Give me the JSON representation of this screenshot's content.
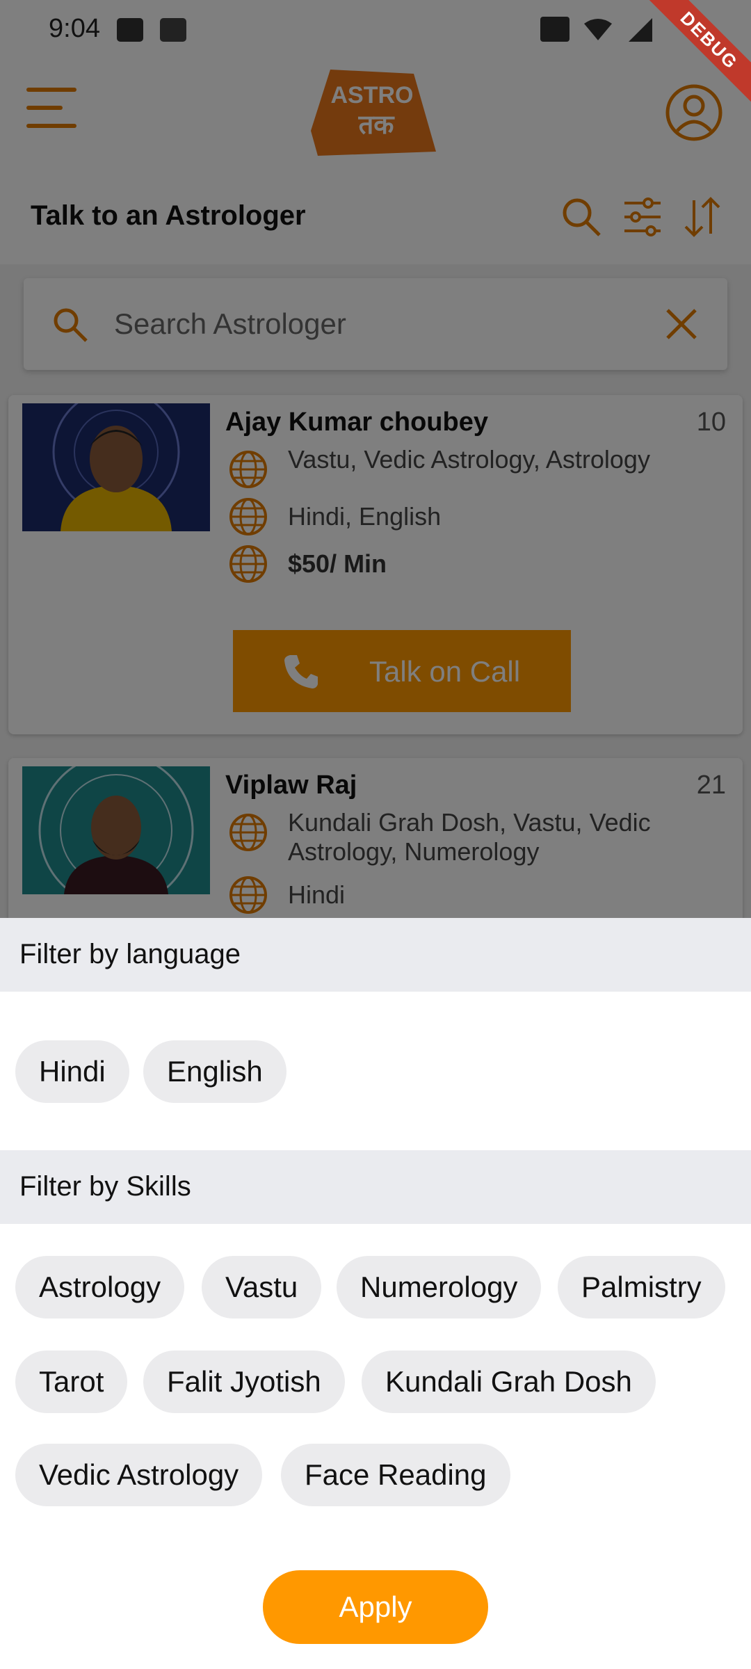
{
  "status_bar": {
    "time": "9:04",
    "debug_label": "DEBUG"
  },
  "header": {
    "logo_top": "ASTRO",
    "logo_bottom": "तक"
  },
  "page": {
    "title": "Talk to an Astrologer"
  },
  "search": {
    "placeholder": "Search Astrologer"
  },
  "astrologers": [
    {
      "name": "Ajay Kumar choubey",
      "experience": "10",
      "skills": "Vastu, Vedic Astrology, Astrology",
      "languages": "Hindi, English",
      "price": "$50/ Min",
      "call_label": "Talk on Call"
    },
    {
      "name": "Viplaw Raj",
      "experience": "21",
      "skills": "Kundali Grah Dosh, Vastu, Vedic Astrology, Numerology",
      "languages": "Hindi"
    }
  ],
  "filter": {
    "language_title": "Filter by language",
    "languages": [
      "Hindi",
      "English"
    ],
    "skills_title": "Filter by Skills",
    "skills": [
      "Astrology",
      "Vastu",
      "Numerology",
      "Palmistry",
      "Tarot",
      "Falit Jyotish",
      "Kundali Grah Dosh",
      "Vedic Astrology",
      "Face Reading"
    ],
    "apply_label": "Apply"
  },
  "colors": {
    "accent": "#ff9800",
    "icon": "#e07b00",
    "chip": "#ebebed",
    "section_header": "#eaebef"
  }
}
